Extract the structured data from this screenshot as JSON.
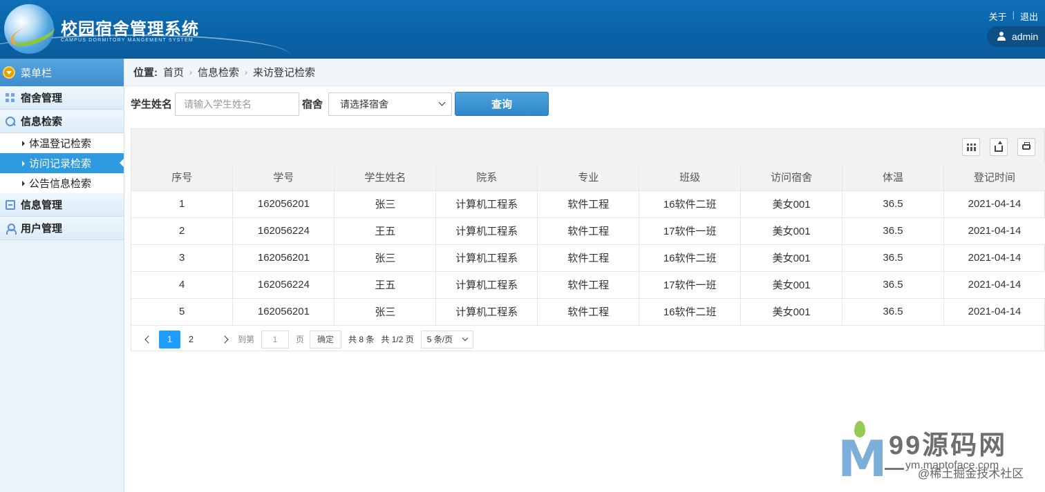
{
  "header": {
    "title": "校园宿舍管理系统",
    "subtitle": "CAMPUS DORMITORY MANGEMENT SYSTEM",
    "links": {
      "about": "关于",
      "logout": "退出"
    },
    "user": "admin"
  },
  "sidebar": {
    "head": "菜单栏",
    "items": [
      {
        "label": "宿舍管理",
        "icon": "grid-icon"
      },
      {
        "label": "信息检索",
        "icon": "search-icon"
      }
    ],
    "sub_items": [
      {
        "label": "体温登记检索",
        "active": false
      },
      {
        "label": "访问记录检索",
        "active": true
      },
      {
        "label": "公告信息检索",
        "active": false
      }
    ],
    "items_after": [
      {
        "label": "信息管理",
        "icon": "card-icon"
      },
      {
        "label": "用户管理",
        "icon": "user-icon"
      }
    ]
  },
  "breadcrumb": {
    "label": "位置:",
    "home": "首页",
    "section": "信息检索",
    "current": "来访登记检索"
  },
  "search": {
    "name_label": "学生姓名",
    "name_placeholder": "请输入学生姓名",
    "dorm_label": "宿舍",
    "dorm_selected": "请选择宿舍",
    "query_button": "查询"
  },
  "table": {
    "headers": [
      "序号",
      "学号",
      "学生姓名",
      "院系",
      "专业",
      "班级",
      "访问宿舍",
      "体温",
      "登记时间"
    ],
    "rows": [
      [
        "1",
        "162056201",
        "张三",
        "计算机工程系",
        "软件工程",
        "16软件二班",
        "美女001",
        "36.5",
        "2021-04-14"
      ],
      [
        "2",
        "162056224",
        "王五",
        "计算机工程系",
        "软件工程",
        "17软件一班",
        "美女001",
        "36.5",
        "2021-04-14"
      ],
      [
        "3",
        "162056201",
        "张三",
        "计算机工程系",
        "软件工程",
        "16软件二班",
        "美女001",
        "36.5",
        "2021-04-14"
      ],
      [
        "4",
        "162056224",
        "王五",
        "计算机工程系",
        "软件工程",
        "17软件一班",
        "美女001",
        "36.5",
        "2021-04-14"
      ],
      [
        "5",
        "162056201",
        "张三",
        "计算机工程系",
        "软件工程",
        "16软件二班",
        "美女001",
        "36.5",
        "2021-04-14"
      ]
    ]
  },
  "pager": {
    "pages": [
      "1",
      "2"
    ],
    "current": "1",
    "goto_label": "到第",
    "goto_value": "1",
    "page_unit": "页",
    "confirm": "确定",
    "total": "共 8 条",
    "total_pages": "共 1/2 页",
    "page_size": "5 条/页"
  },
  "watermark": {
    "brand": "99源码网",
    "url": "ym.maptoface.com",
    "credit": "@稀土掘金技术社区"
  }
}
